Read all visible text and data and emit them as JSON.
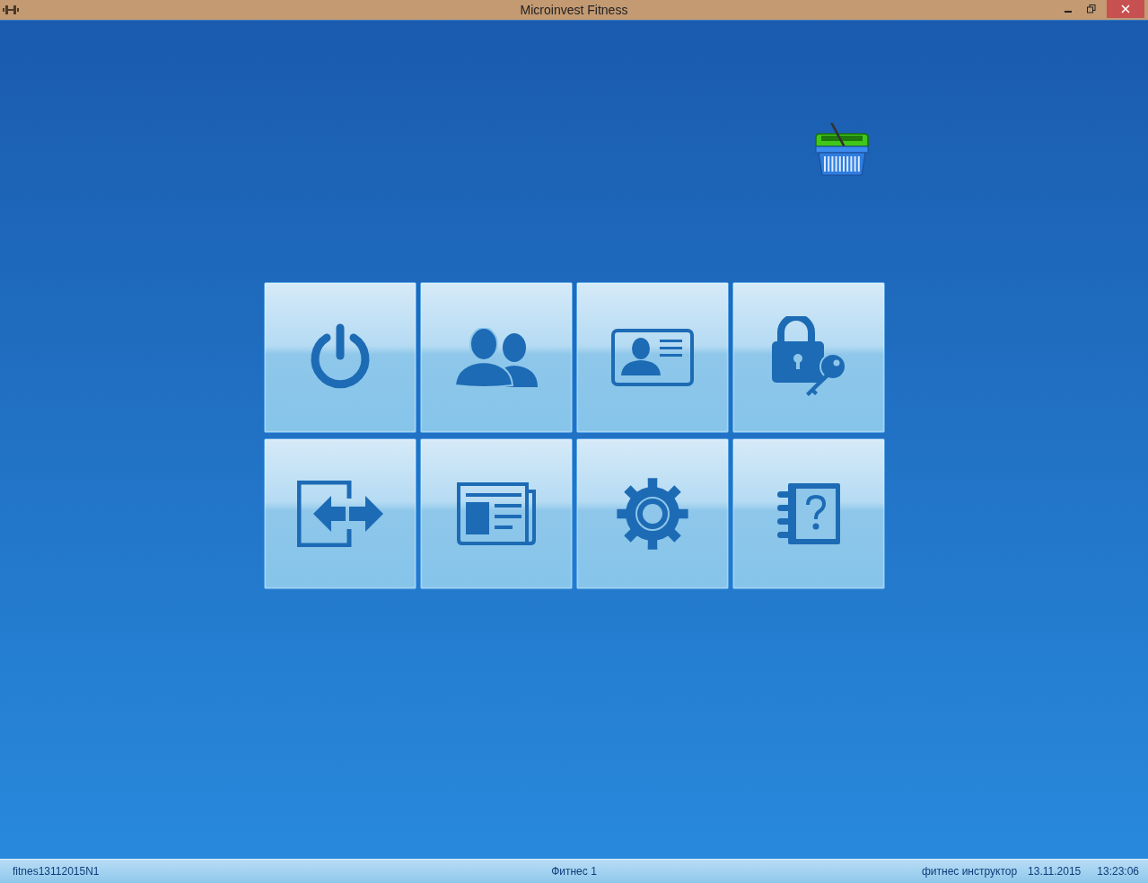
{
  "window": {
    "title": "Microinvest Fitness"
  },
  "status_bar": {
    "left": "fitnes13112015N1",
    "center": "Фитнес 1",
    "user": "фитнес инструктор",
    "date": "13.11.2015",
    "time": "13:23:06"
  }
}
